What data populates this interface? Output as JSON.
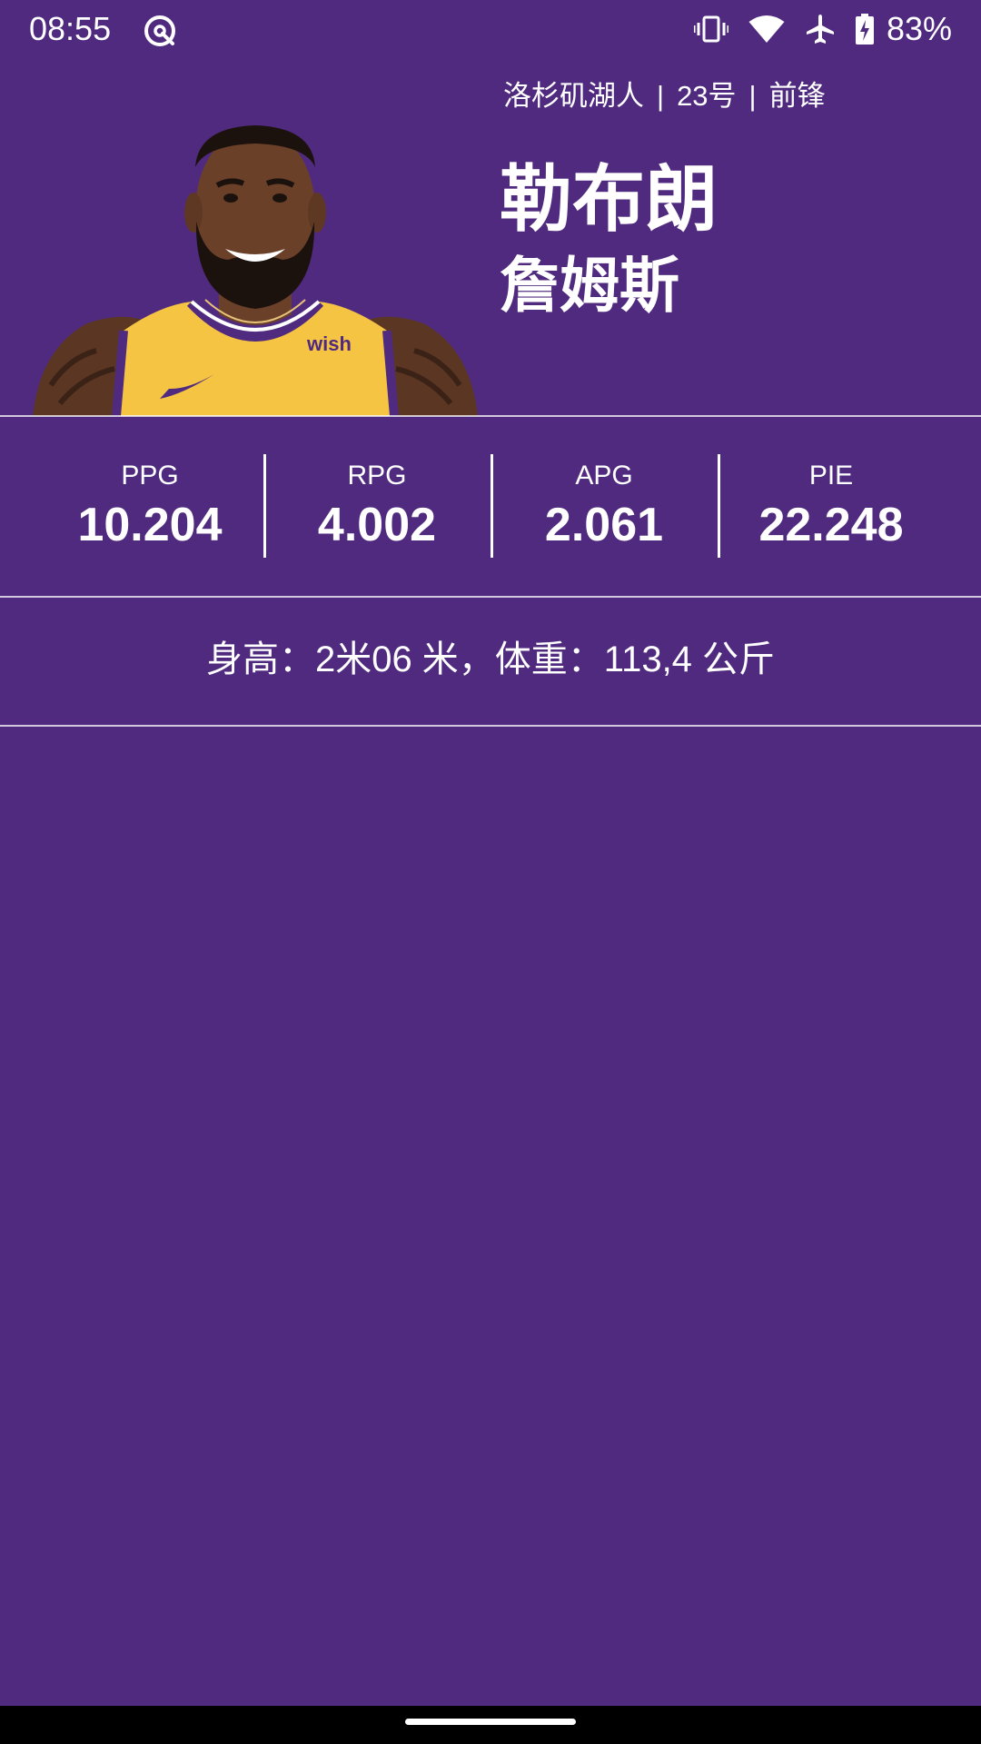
{
  "status_bar": {
    "time": "08:55",
    "battery": "83%",
    "icons": [
      "app-notification-icon",
      "vibrate-icon",
      "wifi-icon",
      "airplane-mode-icon",
      "battery-charging-icon"
    ]
  },
  "player": {
    "team": "洛杉矶湖人",
    "number": "23号",
    "position": "前锋",
    "separator": "|",
    "first_name": "勒布朗",
    "last_name": "詹姆斯",
    "photo": "player-headshot"
  },
  "stats": [
    {
      "label": "PPG",
      "value": "10.204"
    },
    {
      "label": "RPG",
      "value": "4.002"
    },
    {
      "label": "APG",
      "value": "2.061"
    },
    {
      "label": "PIE",
      "value": "22.248"
    }
  ],
  "body_info": "身高：2米06 米，体重：113,4 公斤",
  "colors": {
    "background": "#4f2a7f",
    "text": "#ffffff",
    "jersey": "#f6c443",
    "jersey_trim": "#4f2a7f"
  }
}
